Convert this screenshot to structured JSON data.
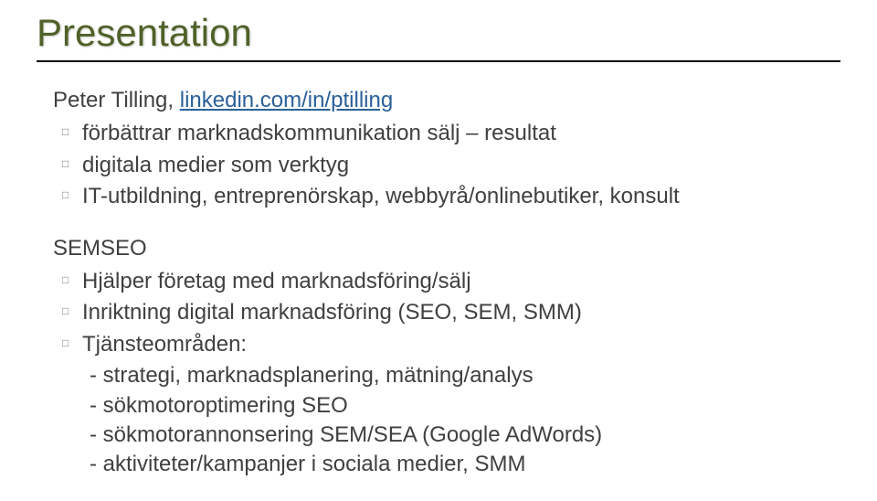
{
  "title": "Presentation",
  "author_prefix": "Peter Tilling, ",
  "author_link": "linkedin.com/in/ptilling",
  "bullets_top": [
    "förbättrar marknadskommunikation sälj – resultat",
    "digitala medier som verktyg",
    "IT-utbildning, entreprenörskap, webbyrå/onlinebutiker, konsult"
  ],
  "section_label": "SEMSEO",
  "bullets_section": [
    "Hjälper företag med marknadsföring/sälj",
    "Inriktning digital marknadsföring (SEO, SEM, SMM)",
    "Tjänsteområden:"
  ],
  "sub_items": [
    "- strategi, marknadsplanering, mätning/analys",
    "- sökmotoroptimering SEO",
    "- sökmotorannonsering SEM/SEA (Google AdWords)",
    "- aktiviteter/kampanjer i sociala medier, SMM"
  ]
}
